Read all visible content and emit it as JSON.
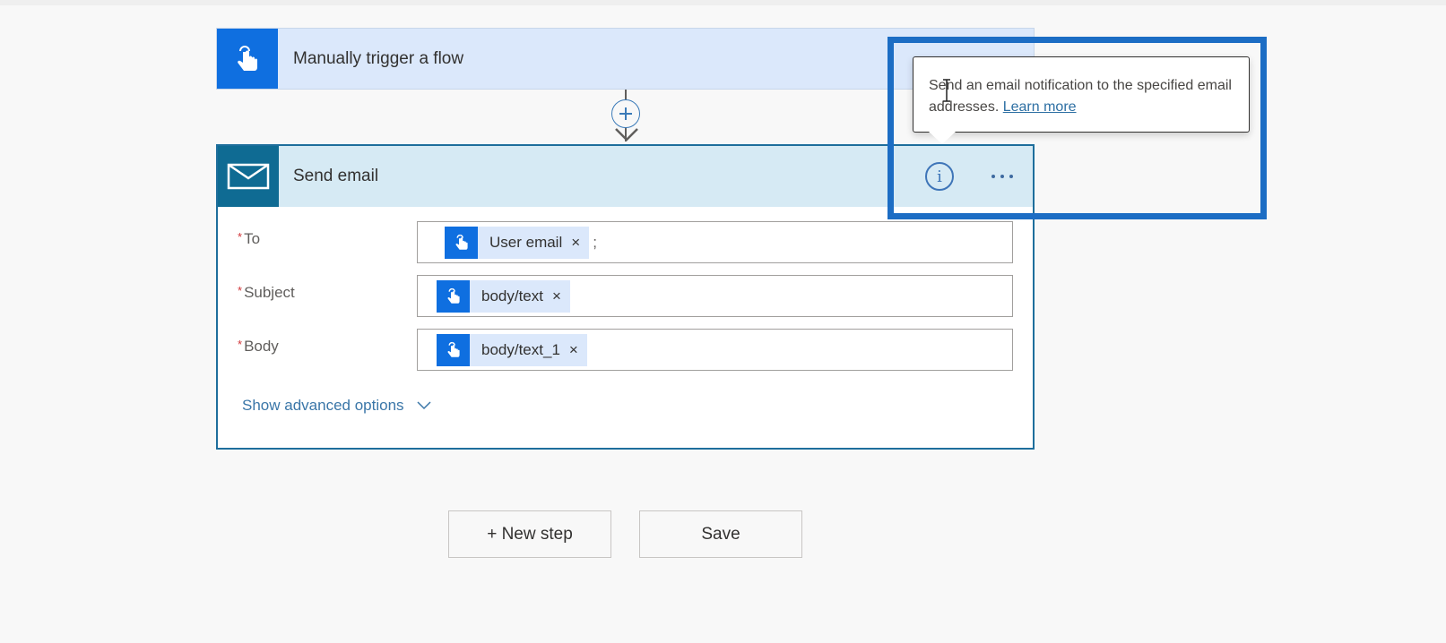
{
  "trigger": {
    "title": "Manually trigger a flow",
    "icon": "touch-hand-icon"
  },
  "connector": {
    "insert_icon": "plus-circle-icon",
    "arrow_icon": "arrow-down-icon"
  },
  "action": {
    "title": "Send email",
    "icon": "mail-icon",
    "info_icon": "info-icon",
    "more_icon": "more-ellipsis-icon",
    "fields": [
      {
        "label": "To",
        "required": true,
        "required_mark": "*",
        "tokens": [
          {
            "label": "User email",
            "remove": "×"
          }
        ],
        "separator": ";"
      },
      {
        "label": "Subject",
        "required": true,
        "required_mark": "*",
        "tokens": [
          {
            "label": "body/text",
            "remove": "×"
          }
        ],
        "separator": ""
      },
      {
        "label": "Body",
        "required": true,
        "required_mark": "*",
        "tokens": [
          {
            "label": "body/text_1",
            "remove": "×"
          }
        ],
        "separator": ""
      }
    ],
    "advanced_label": "Show advanced options"
  },
  "tooltip": {
    "text": "Send an email notification to the specified email addresses.",
    "link": "Learn more"
  },
  "buttons": {
    "new_step": "+ New step",
    "save": "Save"
  },
  "colors": {
    "trigger_accent": "#0f6fe0",
    "action_accent": "#0f6b93",
    "highlight": "#1c6dc4",
    "required": "#d13438",
    "link": "#3a76a8"
  }
}
